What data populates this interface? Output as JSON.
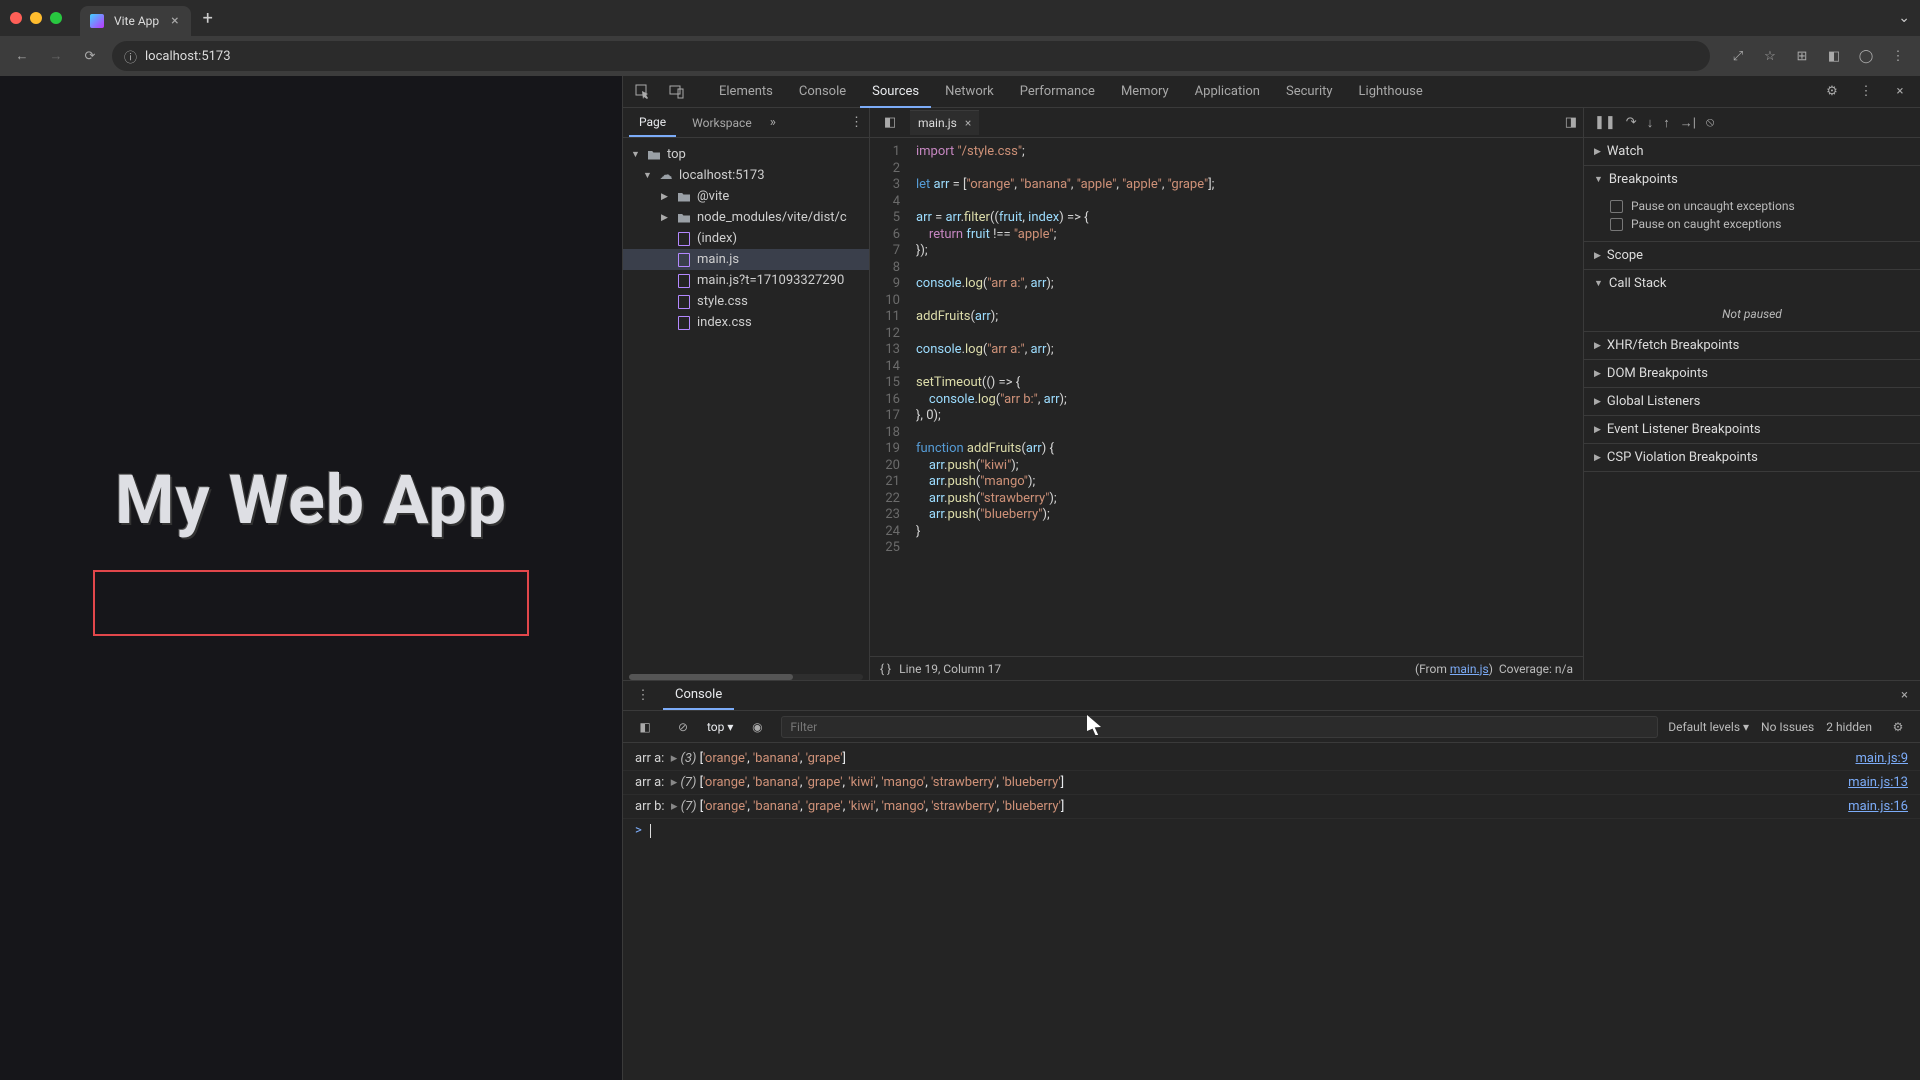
{
  "browser": {
    "tab_title": "Vite App",
    "url": "localhost:5173"
  },
  "page": {
    "heading": "My Web App"
  },
  "devtools": {
    "panels": [
      "Elements",
      "Console",
      "Sources",
      "Network",
      "Performance",
      "Memory",
      "Application",
      "Security",
      "Lighthouse"
    ],
    "active_panel": "Sources",
    "filepane": {
      "tabs": [
        "Page",
        "Workspace"
      ],
      "active": "Page",
      "tree": {
        "top": "top",
        "host": "localhost:5173",
        "folder1": "@vite",
        "folder2": "node_modules/vite/dist/c",
        "files": [
          "(index)",
          "main.js",
          "main.js?t=171093327290",
          "style.css",
          "index.css"
        ],
        "selected": "main.js"
      }
    },
    "editor": {
      "tab": "main.js",
      "status_line": "Line 19, Column 17",
      "from_label": "(From ",
      "from_link": "main.js",
      "from_suffix": ")",
      "coverage": "Coverage: n/a",
      "code_lines": [
        {
          "n": 1,
          "h": "<span class='kw'>import</span> <span class='str'>\"/style.css\"</span>;"
        },
        {
          "n": 2,
          "h": ""
        },
        {
          "n": 3,
          "h": "<span class='kw2'>let</span> <span class='id'>arr</span> = [<span class='str'>\"orange\"</span>, <span class='str'>\"banana\"</span>, <span class='str'>\"apple\"</span>, <span class='str'>\"apple\"</span>, <span class='str'>\"grape\"</span>];"
        },
        {
          "n": 4,
          "h": ""
        },
        {
          "n": 5,
          "h": "<span class='id'>arr</span> = <span class='id'>arr</span>.<span class='fn'>filter</span>((<span class='id'>fruit</span>, <span class='id'>index</span>) =&gt; {"
        },
        {
          "n": 6,
          "h": "    <span class='kw'>return</span> <span class='id'>fruit</span> !== <span class='str'>\"apple\"</span>;"
        },
        {
          "n": 7,
          "h": "});"
        },
        {
          "n": 8,
          "h": ""
        },
        {
          "n": 9,
          "h": "<span class='id'>console</span>.<span class='fn'>log</span>(<span class='str'>\"arr a:\"</span>, <span class='id'>arr</span>);"
        },
        {
          "n": 10,
          "h": ""
        },
        {
          "n": 11,
          "h": "<span class='fn'>addFruits</span>(<span class='id'>arr</span>);"
        },
        {
          "n": 12,
          "h": ""
        },
        {
          "n": 13,
          "h": "<span class='id'>console</span>.<span class='fn'>log</span>(<span class='str'>\"arr a:\"</span>, <span class='id'>arr</span>);"
        },
        {
          "n": 14,
          "h": ""
        },
        {
          "n": 15,
          "h": "<span class='fn'>setTimeout</span>(() =&gt; {"
        },
        {
          "n": 16,
          "h": "    <span class='id'>console</span>.<span class='fn'>log</span>(<span class='str'>\"arr b:\"</span>, <span class='id'>arr</span>);"
        },
        {
          "n": 17,
          "h": "}, <span class='pn'>0</span>);"
        },
        {
          "n": 18,
          "h": ""
        },
        {
          "n": 19,
          "h": "<span class='kw2'>function</span> <span class='fn'>addFruits</span>(<span class='id'>arr</span>) {"
        },
        {
          "n": 20,
          "h": "    <span class='id'>arr</span>.<span class='fn'>push</span>(<span class='str'>\"kiwi\"</span>);"
        },
        {
          "n": 21,
          "h": "    <span class='id'>arr</span>.<span class='fn'>push</span>(<span class='str'>\"mango\"</span>);"
        },
        {
          "n": 22,
          "h": "    <span class='id'>arr</span>.<span class='fn'>push</span>(<span class='str'>\"strawberry\"</span>);"
        },
        {
          "n": 23,
          "h": "    <span class='id'>arr</span>.<span class='fn'>push</span>(<span class='str'>\"blueberry\"</span>);"
        },
        {
          "n": 24,
          "h": "}"
        },
        {
          "n": 25,
          "h": ""
        }
      ]
    },
    "debugger": {
      "sections": {
        "watch": "Watch",
        "breakpoints": "Breakpoints",
        "bp_uncaught": "Pause on uncaught exceptions",
        "bp_caught": "Pause on caught exceptions",
        "scope": "Scope",
        "callstack": "Call Stack",
        "callstack_state": "Not paused",
        "xhr": "XHR/fetch Breakpoints",
        "dom": "DOM Breakpoints",
        "listeners": "Global Listeners",
        "event": "Event Listener Breakpoints",
        "csp": "CSP Violation Breakpoints"
      }
    },
    "console": {
      "tab": "Console",
      "context": "top",
      "filter_placeholder": "Filter",
      "levels": "Default levels",
      "issues": "No Issues",
      "hidden": "2 hidden",
      "rows": [
        {
          "label": "arr a:",
          "count": "(3)",
          "items": [
            "'orange'",
            "'banana'",
            "'grape'"
          ],
          "src": "main.js:9"
        },
        {
          "label": "arr a:",
          "count": "(7)",
          "items": [
            "'orange'",
            "'banana'",
            "'grape'",
            "'kiwi'",
            "'mango'",
            "'strawberry'",
            "'blueberry'"
          ],
          "src": "main.js:13"
        },
        {
          "label": "arr b:",
          "count": "(7)",
          "items": [
            "'orange'",
            "'banana'",
            "'grape'",
            "'kiwi'",
            "'mango'",
            "'strawberry'",
            "'blueberry'"
          ],
          "src": "main.js:16"
        }
      ]
    }
  }
}
